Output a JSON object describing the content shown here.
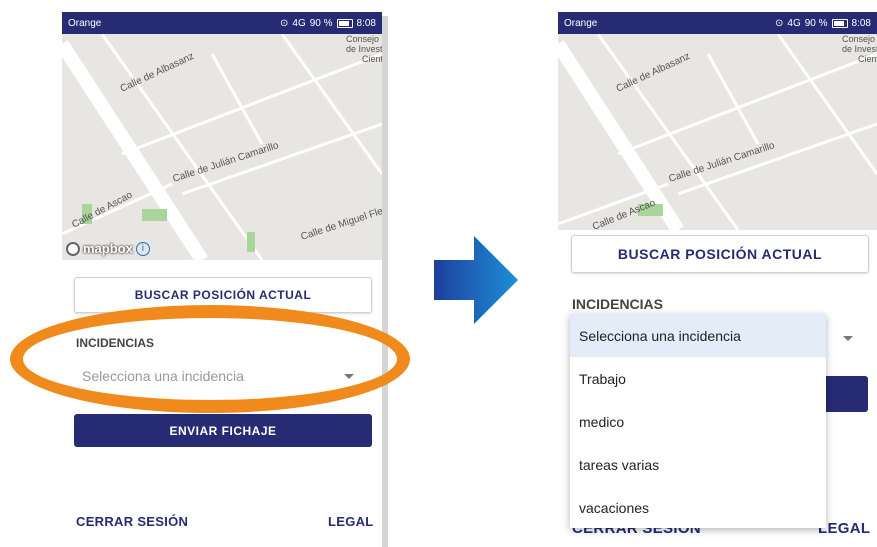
{
  "status_bar": {
    "carrier": "Orange",
    "signal_text": "4G",
    "battery": "90 %",
    "time": "8:08"
  },
  "map": {
    "streets": [
      "Calle de Albasanz",
      "Calle de Julián Camarillo",
      "Calle de Ascao",
      "Calle de Miguel Fleta"
    ],
    "poi": [
      "Consejo",
      "de Invest",
      "Cient"
    ],
    "logo": "mapbox",
    "info": "i"
  },
  "form": {
    "locate_button": "BUSCAR POSICIÓN ACTUAL",
    "incident_label": "INCIDENCIAS",
    "incident_placeholder": "Selecciona una incidencia",
    "send_button": "ENVIAR FICHAJE",
    "logout_link": "CERRAR SESIÓN",
    "legal_link": "LEGAL"
  },
  "dropdown": {
    "options": [
      "Selecciona una incidencia",
      "Trabajo",
      "medico",
      "tareas varias",
      "vacaciones"
    ],
    "selected_index": 0
  },
  "colors": {
    "primary": "#262b73",
    "highlight": "#f08a1d",
    "arrow": "#1a73c8",
    "map_bg": "#e8e6e2"
  }
}
